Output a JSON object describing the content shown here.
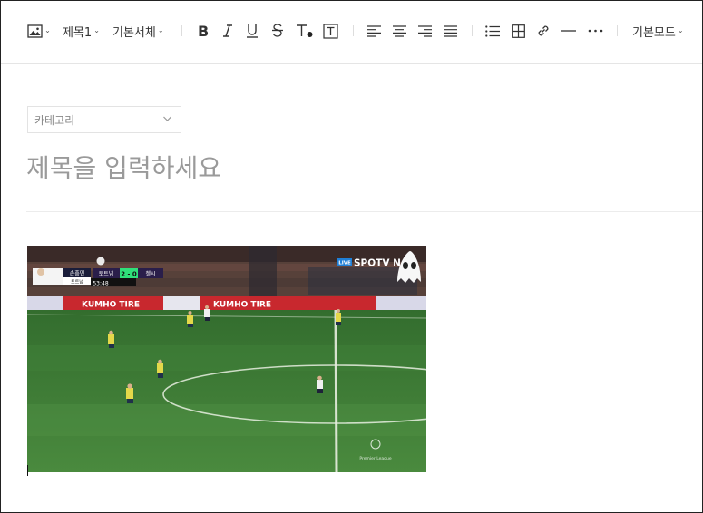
{
  "toolbar": {
    "heading_label": "제목1",
    "font_label": "기본서체",
    "mode_label": "기본모드"
  },
  "category": {
    "label": "카테고리"
  },
  "title": {
    "placeholder": "제목을 입력하세요"
  },
  "media": {
    "broadcaster": "SPOTV N",
    "live_label": "LIVE",
    "score": "2 - 0",
    "team_home": "토트넘",
    "team_away": "첼시",
    "clock": "53:48",
    "player_name": "손흥민",
    "player_team": "토트넘",
    "board_ad": "KUMHO TIRE",
    "league_mark": "Premier League"
  },
  "colors": {
    "pitch": "#3e7a36",
    "stand": "#5a3a33",
    "board": "#c8282e"
  }
}
